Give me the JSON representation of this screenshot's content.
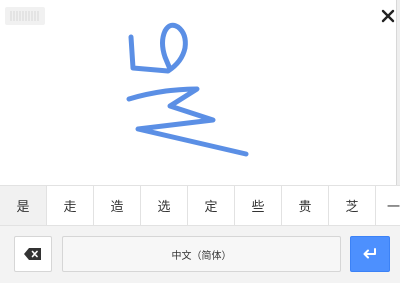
{
  "candidates": [
    "是",
    "走",
    "造",
    "选",
    "定",
    "些",
    "贵",
    "芝",
    "一"
  ],
  "language_button": {
    "label": "中文（简体）"
  },
  "colors": {
    "ink": "#5b8fe5",
    "enter_button": "#4d90fe"
  },
  "icons": {
    "drag_handle": "drag-handle-icon",
    "close": "close-icon",
    "backspace": "backspace-icon",
    "enter": "enter-icon"
  }
}
